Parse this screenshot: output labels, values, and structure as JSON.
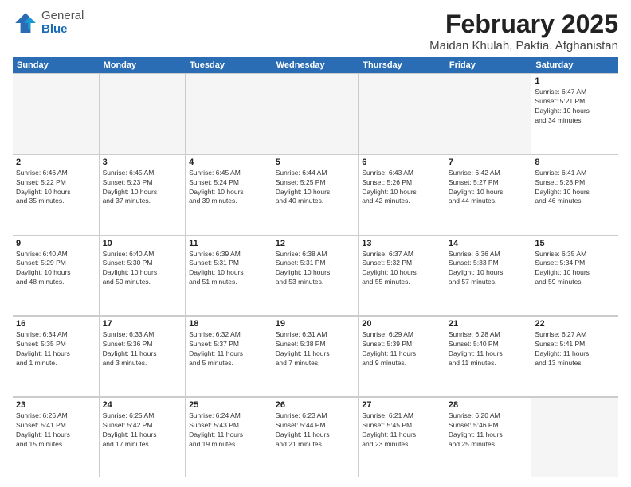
{
  "header": {
    "logo_general": "General",
    "logo_blue": "Blue",
    "title": "February 2025",
    "subtitle": "Maidan Khulah, Paktia, Afghanistan"
  },
  "calendar": {
    "days_of_week": [
      "Sunday",
      "Monday",
      "Tuesday",
      "Wednesday",
      "Thursday",
      "Friday",
      "Saturday"
    ],
    "weeks": [
      [
        {
          "day": "",
          "empty": true
        },
        {
          "day": "",
          "empty": true
        },
        {
          "day": "",
          "empty": true
        },
        {
          "day": "",
          "empty": true
        },
        {
          "day": "",
          "empty": true
        },
        {
          "day": "",
          "empty": true
        },
        {
          "day": "1",
          "info": "Sunrise: 6:47 AM\nSunset: 5:21 PM\nDaylight: 10 hours\nand 34 minutes."
        }
      ],
      [
        {
          "day": "2",
          "info": "Sunrise: 6:46 AM\nSunset: 5:22 PM\nDaylight: 10 hours\nand 35 minutes."
        },
        {
          "day": "3",
          "info": "Sunrise: 6:45 AM\nSunset: 5:23 PM\nDaylight: 10 hours\nand 37 minutes."
        },
        {
          "day": "4",
          "info": "Sunrise: 6:45 AM\nSunset: 5:24 PM\nDaylight: 10 hours\nand 39 minutes."
        },
        {
          "day": "5",
          "info": "Sunrise: 6:44 AM\nSunset: 5:25 PM\nDaylight: 10 hours\nand 40 minutes."
        },
        {
          "day": "6",
          "info": "Sunrise: 6:43 AM\nSunset: 5:26 PM\nDaylight: 10 hours\nand 42 minutes."
        },
        {
          "day": "7",
          "info": "Sunrise: 6:42 AM\nSunset: 5:27 PM\nDaylight: 10 hours\nand 44 minutes."
        },
        {
          "day": "8",
          "info": "Sunrise: 6:41 AM\nSunset: 5:28 PM\nDaylight: 10 hours\nand 46 minutes."
        }
      ],
      [
        {
          "day": "9",
          "info": "Sunrise: 6:40 AM\nSunset: 5:29 PM\nDaylight: 10 hours\nand 48 minutes."
        },
        {
          "day": "10",
          "info": "Sunrise: 6:40 AM\nSunset: 5:30 PM\nDaylight: 10 hours\nand 50 minutes."
        },
        {
          "day": "11",
          "info": "Sunrise: 6:39 AM\nSunset: 5:31 PM\nDaylight: 10 hours\nand 51 minutes."
        },
        {
          "day": "12",
          "info": "Sunrise: 6:38 AM\nSunset: 5:31 PM\nDaylight: 10 hours\nand 53 minutes."
        },
        {
          "day": "13",
          "info": "Sunrise: 6:37 AM\nSunset: 5:32 PM\nDaylight: 10 hours\nand 55 minutes."
        },
        {
          "day": "14",
          "info": "Sunrise: 6:36 AM\nSunset: 5:33 PM\nDaylight: 10 hours\nand 57 minutes."
        },
        {
          "day": "15",
          "info": "Sunrise: 6:35 AM\nSunset: 5:34 PM\nDaylight: 10 hours\nand 59 minutes."
        }
      ],
      [
        {
          "day": "16",
          "info": "Sunrise: 6:34 AM\nSunset: 5:35 PM\nDaylight: 11 hours\nand 1 minute."
        },
        {
          "day": "17",
          "info": "Sunrise: 6:33 AM\nSunset: 5:36 PM\nDaylight: 11 hours\nand 3 minutes."
        },
        {
          "day": "18",
          "info": "Sunrise: 6:32 AM\nSunset: 5:37 PM\nDaylight: 11 hours\nand 5 minutes."
        },
        {
          "day": "19",
          "info": "Sunrise: 6:31 AM\nSunset: 5:38 PM\nDaylight: 11 hours\nand 7 minutes."
        },
        {
          "day": "20",
          "info": "Sunrise: 6:29 AM\nSunset: 5:39 PM\nDaylight: 11 hours\nand 9 minutes."
        },
        {
          "day": "21",
          "info": "Sunrise: 6:28 AM\nSunset: 5:40 PM\nDaylight: 11 hours\nand 11 minutes."
        },
        {
          "day": "22",
          "info": "Sunrise: 6:27 AM\nSunset: 5:41 PM\nDaylight: 11 hours\nand 13 minutes."
        }
      ],
      [
        {
          "day": "23",
          "info": "Sunrise: 6:26 AM\nSunset: 5:41 PM\nDaylight: 11 hours\nand 15 minutes."
        },
        {
          "day": "24",
          "info": "Sunrise: 6:25 AM\nSunset: 5:42 PM\nDaylight: 11 hours\nand 17 minutes."
        },
        {
          "day": "25",
          "info": "Sunrise: 6:24 AM\nSunset: 5:43 PM\nDaylight: 11 hours\nand 19 minutes."
        },
        {
          "day": "26",
          "info": "Sunrise: 6:23 AM\nSunset: 5:44 PM\nDaylight: 11 hours\nand 21 minutes."
        },
        {
          "day": "27",
          "info": "Sunrise: 6:21 AM\nSunset: 5:45 PM\nDaylight: 11 hours\nand 23 minutes."
        },
        {
          "day": "28",
          "info": "Sunrise: 6:20 AM\nSunset: 5:46 PM\nDaylight: 11 hours\nand 25 minutes."
        },
        {
          "day": "",
          "empty": true
        }
      ]
    ]
  }
}
